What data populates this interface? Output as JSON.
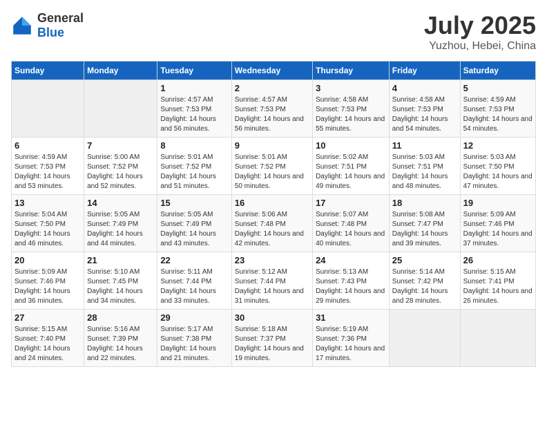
{
  "logo": {
    "general": "General",
    "blue": "Blue"
  },
  "title": "July 2025",
  "subtitle": "Yuzhou, Hebei, China",
  "days_of_week": [
    "Sunday",
    "Monday",
    "Tuesday",
    "Wednesday",
    "Thursday",
    "Friday",
    "Saturday"
  ],
  "weeks": [
    [
      {
        "day": "",
        "sunrise": "",
        "sunset": "",
        "daylight": ""
      },
      {
        "day": "",
        "sunrise": "",
        "sunset": "",
        "daylight": ""
      },
      {
        "day": "1",
        "sunrise": "Sunrise: 4:57 AM",
        "sunset": "Sunset: 7:53 PM",
        "daylight": "Daylight: 14 hours and 56 minutes."
      },
      {
        "day": "2",
        "sunrise": "Sunrise: 4:57 AM",
        "sunset": "Sunset: 7:53 PM",
        "daylight": "Daylight: 14 hours and 56 minutes."
      },
      {
        "day": "3",
        "sunrise": "Sunrise: 4:58 AM",
        "sunset": "Sunset: 7:53 PM",
        "daylight": "Daylight: 14 hours and 55 minutes."
      },
      {
        "day": "4",
        "sunrise": "Sunrise: 4:58 AM",
        "sunset": "Sunset: 7:53 PM",
        "daylight": "Daylight: 14 hours and 54 minutes."
      },
      {
        "day": "5",
        "sunrise": "Sunrise: 4:59 AM",
        "sunset": "Sunset: 7:53 PM",
        "daylight": "Daylight: 14 hours and 54 minutes."
      }
    ],
    [
      {
        "day": "6",
        "sunrise": "Sunrise: 4:59 AM",
        "sunset": "Sunset: 7:53 PM",
        "daylight": "Daylight: 14 hours and 53 minutes."
      },
      {
        "day": "7",
        "sunrise": "Sunrise: 5:00 AM",
        "sunset": "Sunset: 7:52 PM",
        "daylight": "Daylight: 14 hours and 52 minutes."
      },
      {
        "day": "8",
        "sunrise": "Sunrise: 5:01 AM",
        "sunset": "Sunset: 7:52 PM",
        "daylight": "Daylight: 14 hours and 51 minutes."
      },
      {
        "day": "9",
        "sunrise": "Sunrise: 5:01 AM",
        "sunset": "Sunset: 7:52 PM",
        "daylight": "Daylight: 14 hours and 50 minutes."
      },
      {
        "day": "10",
        "sunrise": "Sunrise: 5:02 AM",
        "sunset": "Sunset: 7:51 PM",
        "daylight": "Daylight: 14 hours and 49 minutes."
      },
      {
        "day": "11",
        "sunrise": "Sunrise: 5:03 AM",
        "sunset": "Sunset: 7:51 PM",
        "daylight": "Daylight: 14 hours and 48 minutes."
      },
      {
        "day": "12",
        "sunrise": "Sunrise: 5:03 AM",
        "sunset": "Sunset: 7:50 PM",
        "daylight": "Daylight: 14 hours and 47 minutes."
      }
    ],
    [
      {
        "day": "13",
        "sunrise": "Sunrise: 5:04 AM",
        "sunset": "Sunset: 7:50 PM",
        "daylight": "Daylight: 14 hours and 46 minutes."
      },
      {
        "day": "14",
        "sunrise": "Sunrise: 5:05 AM",
        "sunset": "Sunset: 7:49 PM",
        "daylight": "Daylight: 14 hours and 44 minutes."
      },
      {
        "day": "15",
        "sunrise": "Sunrise: 5:05 AM",
        "sunset": "Sunset: 7:49 PM",
        "daylight": "Daylight: 14 hours and 43 minutes."
      },
      {
        "day": "16",
        "sunrise": "Sunrise: 5:06 AM",
        "sunset": "Sunset: 7:48 PM",
        "daylight": "Daylight: 14 hours and 42 minutes."
      },
      {
        "day": "17",
        "sunrise": "Sunrise: 5:07 AM",
        "sunset": "Sunset: 7:48 PM",
        "daylight": "Daylight: 14 hours and 40 minutes."
      },
      {
        "day": "18",
        "sunrise": "Sunrise: 5:08 AM",
        "sunset": "Sunset: 7:47 PM",
        "daylight": "Daylight: 14 hours and 39 minutes."
      },
      {
        "day": "19",
        "sunrise": "Sunrise: 5:09 AM",
        "sunset": "Sunset: 7:46 PM",
        "daylight": "Daylight: 14 hours and 37 minutes."
      }
    ],
    [
      {
        "day": "20",
        "sunrise": "Sunrise: 5:09 AM",
        "sunset": "Sunset: 7:46 PM",
        "daylight": "Daylight: 14 hours and 36 minutes."
      },
      {
        "day": "21",
        "sunrise": "Sunrise: 5:10 AM",
        "sunset": "Sunset: 7:45 PM",
        "daylight": "Daylight: 14 hours and 34 minutes."
      },
      {
        "day": "22",
        "sunrise": "Sunrise: 5:11 AM",
        "sunset": "Sunset: 7:44 PM",
        "daylight": "Daylight: 14 hours and 33 minutes."
      },
      {
        "day": "23",
        "sunrise": "Sunrise: 5:12 AM",
        "sunset": "Sunset: 7:44 PM",
        "daylight": "Daylight: 14 hours and 31 minutes."
      },
      {
        "day": "24",
        "sunrise": "Sunrise: 5:13 AM",
        "sunset": "Sunset: 7:43 PM",
        "daylight": "Daylight: 14 hours and 29 minutes."
      },
      {
        "day": "25",
        "sunrise": "Sunrise: 5:14 AM",
        "sunset": "Sunset: 7:42 PM",
        "daylight": "Daylight: 14 hours and 28 minutes."
      },
      {
        "day": "26",
        "sunrise": "Sunrise: 5:15 AM",
        "sunset": "Sunset: 7:41 PM",
        "daylight": "Daylight: 14 hours and 26 minutes."
      }
    ],
    [
      {
        "day": "27",
        "sunrise": "Sunrise: 5:15 AM",
        "sunset": "Sunset: 7:40 PM",
        "daylight": "Daylight: 14 hours and 24 minutes."
      },
      {
        "day": "28",
        "sunrise": "Sunrise: 5:16 AM",
        "sunset": "Sunset: 7:39 PM",
        "daylight": "Daylight: 14 hours and 22 minutes."
      },
      {
        "day": "29",
        "sunrise": "Sunrise: 5:17 AM",
        "sunset": "Sunset: 7:38 PM",
        "daylight": "Daylight: 14 hours and 21 minutes."
      },
      {
        "day": "30",
        "sunrise": "Sunrise: 5:18 AM",
        "sunset": "Sunset: 7:37 PM",
        "daylight": "Daylight: 14 hours and 19 minutes."
      },
      {
        "day": "31",
        "sunrise": "Sunrise: 5:19 AM",
        "sunset": "Sunset: 7:36 PM",
        "daylight": "Daylight: 14 hours and 17 minutes."
      },
      {
        "day": "",
        "sunrise": "",
        "sunset": "",
        "daylight": ""
      },
      {
        "day": "",
        "sunrise": "",
        "sunset": "",
        "daylight": ""
      }
    ]
  ]
}
